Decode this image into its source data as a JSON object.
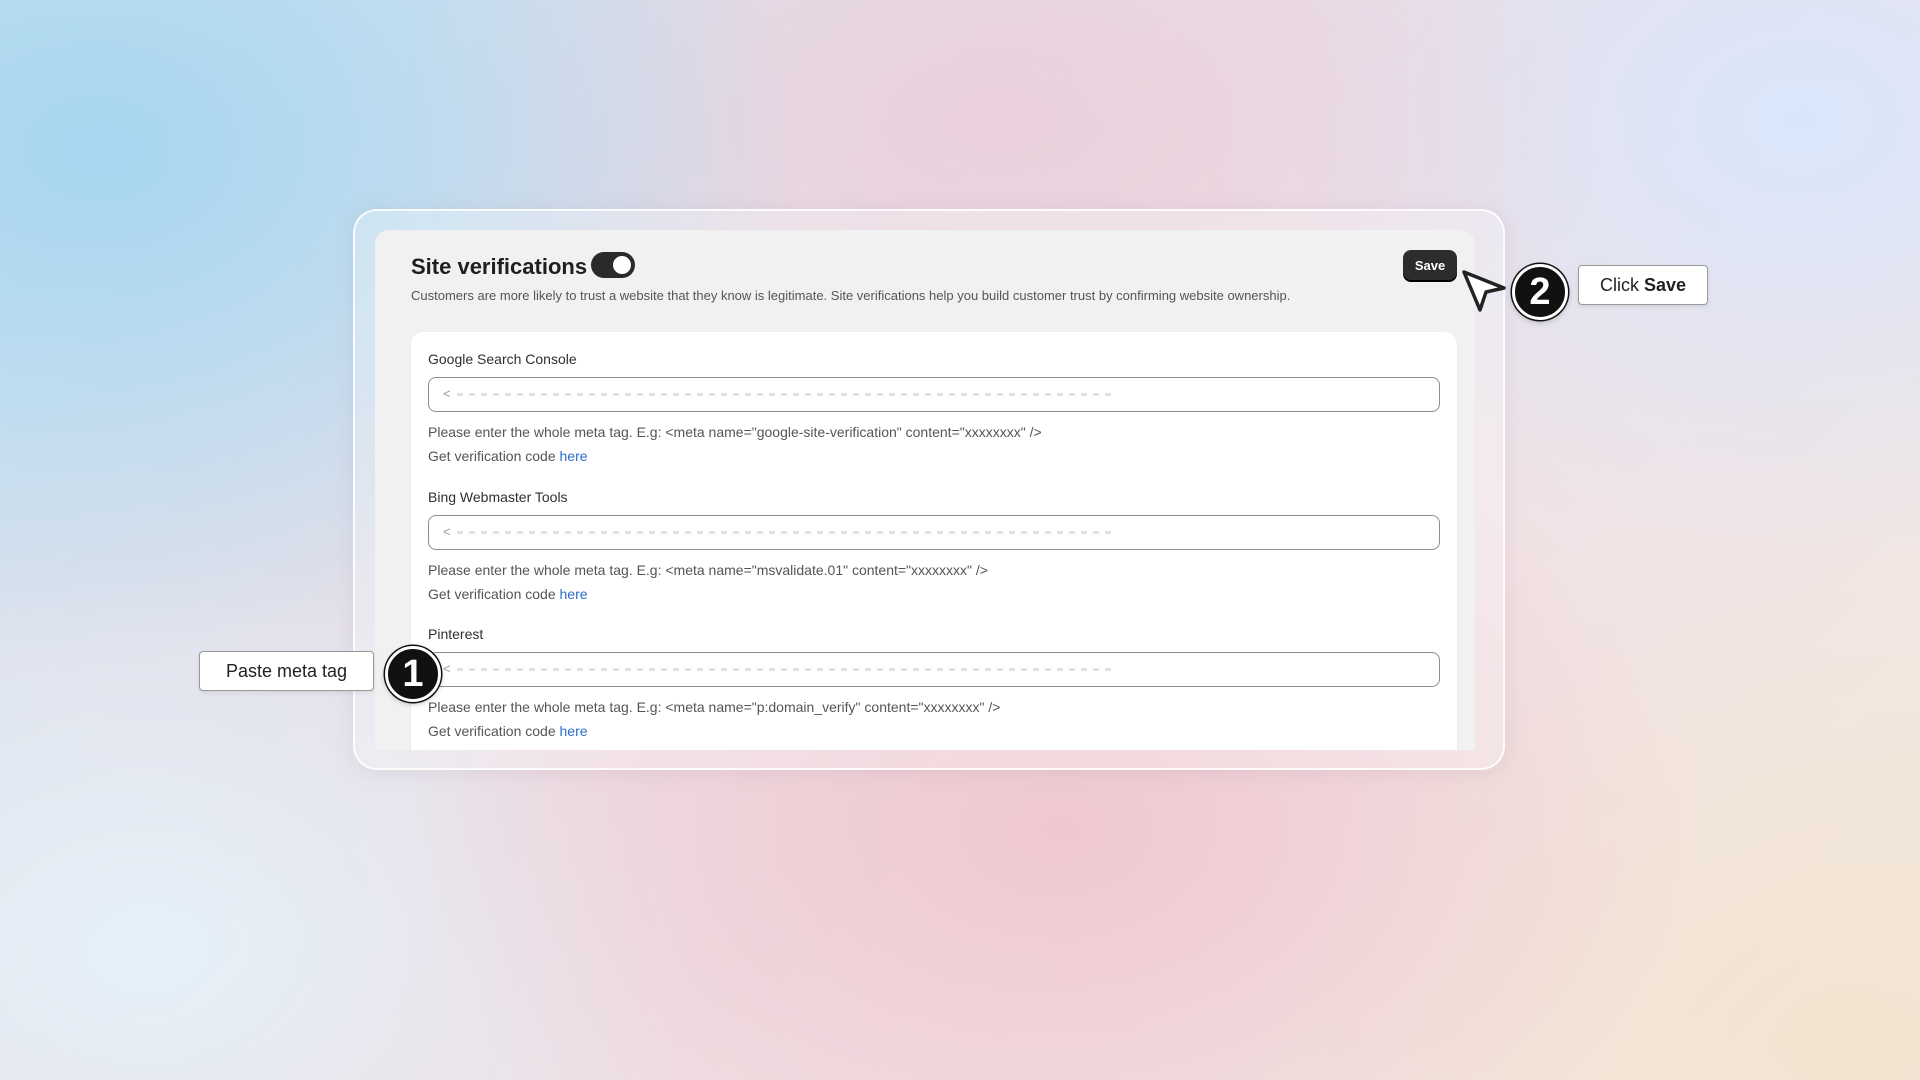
{
  "panel": {
    "title": "Site verifications",
    "toggle_on": true,
    "description": "Customers are more likely to trust a website that they know is legitimate. Site verifications help you build customer trust by confirming website ownership.",
    "save_label": "Save"
  },
  "sections": [
    {
      "label": "Google Search Console",
      "value": "<",
      "hint": "Please enter the whole meta tag. E.g: <meta name=\"google-site-verification\" content=\"xxxxxxxx\" />",
      "code_prefix": "Get verification code",
      "code_link": "here"
    },
    {
      "label": "Bing Webmaster Tools",
      "value": "<",
      "hint": "Please enter the whole meta tag. E.g: <meta name=\"msvalidate.01\" content=\"xxxxxxxx\" />",
      "code_prefix": "Get verification code",
      "code_link": "here"
    },
    {
      "label": "Pinterest",
      "value": "<",
      "hint": "Please enter the whole meta tag. E.g: <meta name=\"p:domain_verify\" content=\"xxxxxxxx\" />",
      "code_prefix": "Get verification code",
      "code_link": "here"
    }
  ],
  "annotations": {
    "step1": {
      "number": "1",
      "label": "Paste meta tag"
    },
    "step2": {
      "number": "2",
      "label_prefix": "Click",
      "label_bold": "Save"
    }
  },
  "colors": {
    "accent_dark": "#2c2c2c",
    "link": "#2c6ecb"
  }
}
